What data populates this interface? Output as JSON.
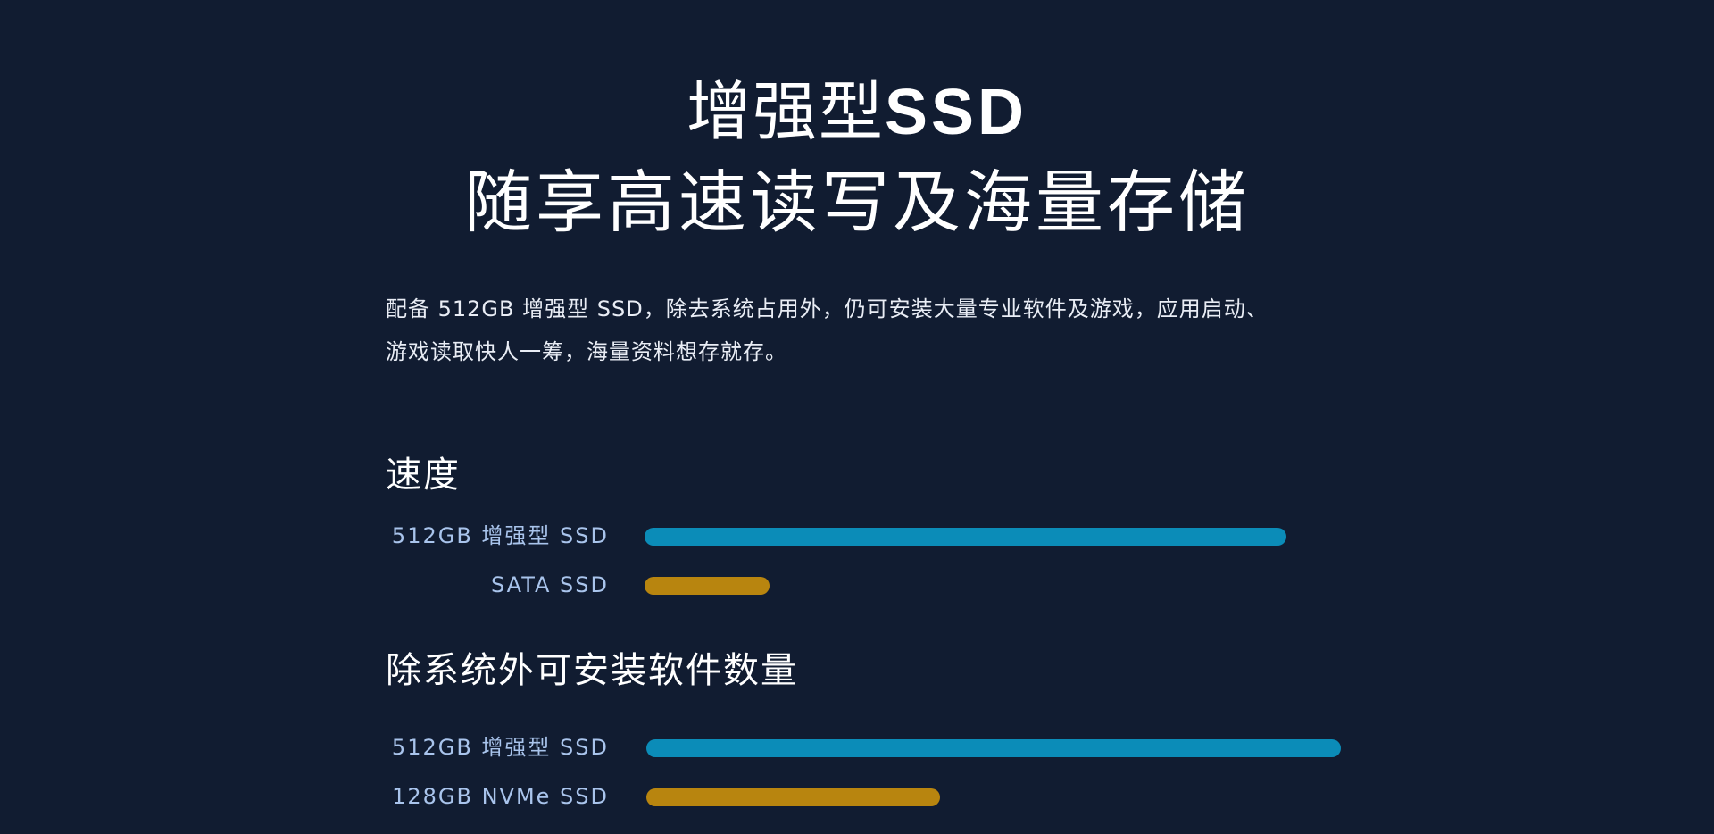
{
  "hero": {
    "line1_cjk": "增强型",
    "line1_latin": "SSD",
    "line2": "随享高速读写及海量存储"
  },
  "intro": {
    "line1": "配备 512GB 增强型 SSD，除去系统占用外，仍可安装大量专业软件及游戏，应用启动、",
    "line2": "游戏读取快人一筹，海量资料想存就存。"
  },
  "colors": {
    "background": "#111c31",
    "primary_bar": "#0b8cb8",
    "secondary_bar": "#b8850f",
    "label": "#a9c4ec"
  },
  "chart_data": [
    {
      "type": "bar",
      "title": "速度",
      "orientation": "horizontal",
      "categories": [
        "512GB 增强型 SSD",
        "SATA SSD"
      ],
      "values": [
        100,
        19.5
      ],
      "unit": "relative"
    },
    {
      "type": "bar",
      "title": "除系统外可安装软件数量",
      "orientation": "horizontal",
      "categories": [
        "512GB 增强型 SSD",
        "128GB NVMe SSD"
      ],
      "values": [
        100,
        42.3
      ],
      "unit": "relative"
    }
  ]
}
